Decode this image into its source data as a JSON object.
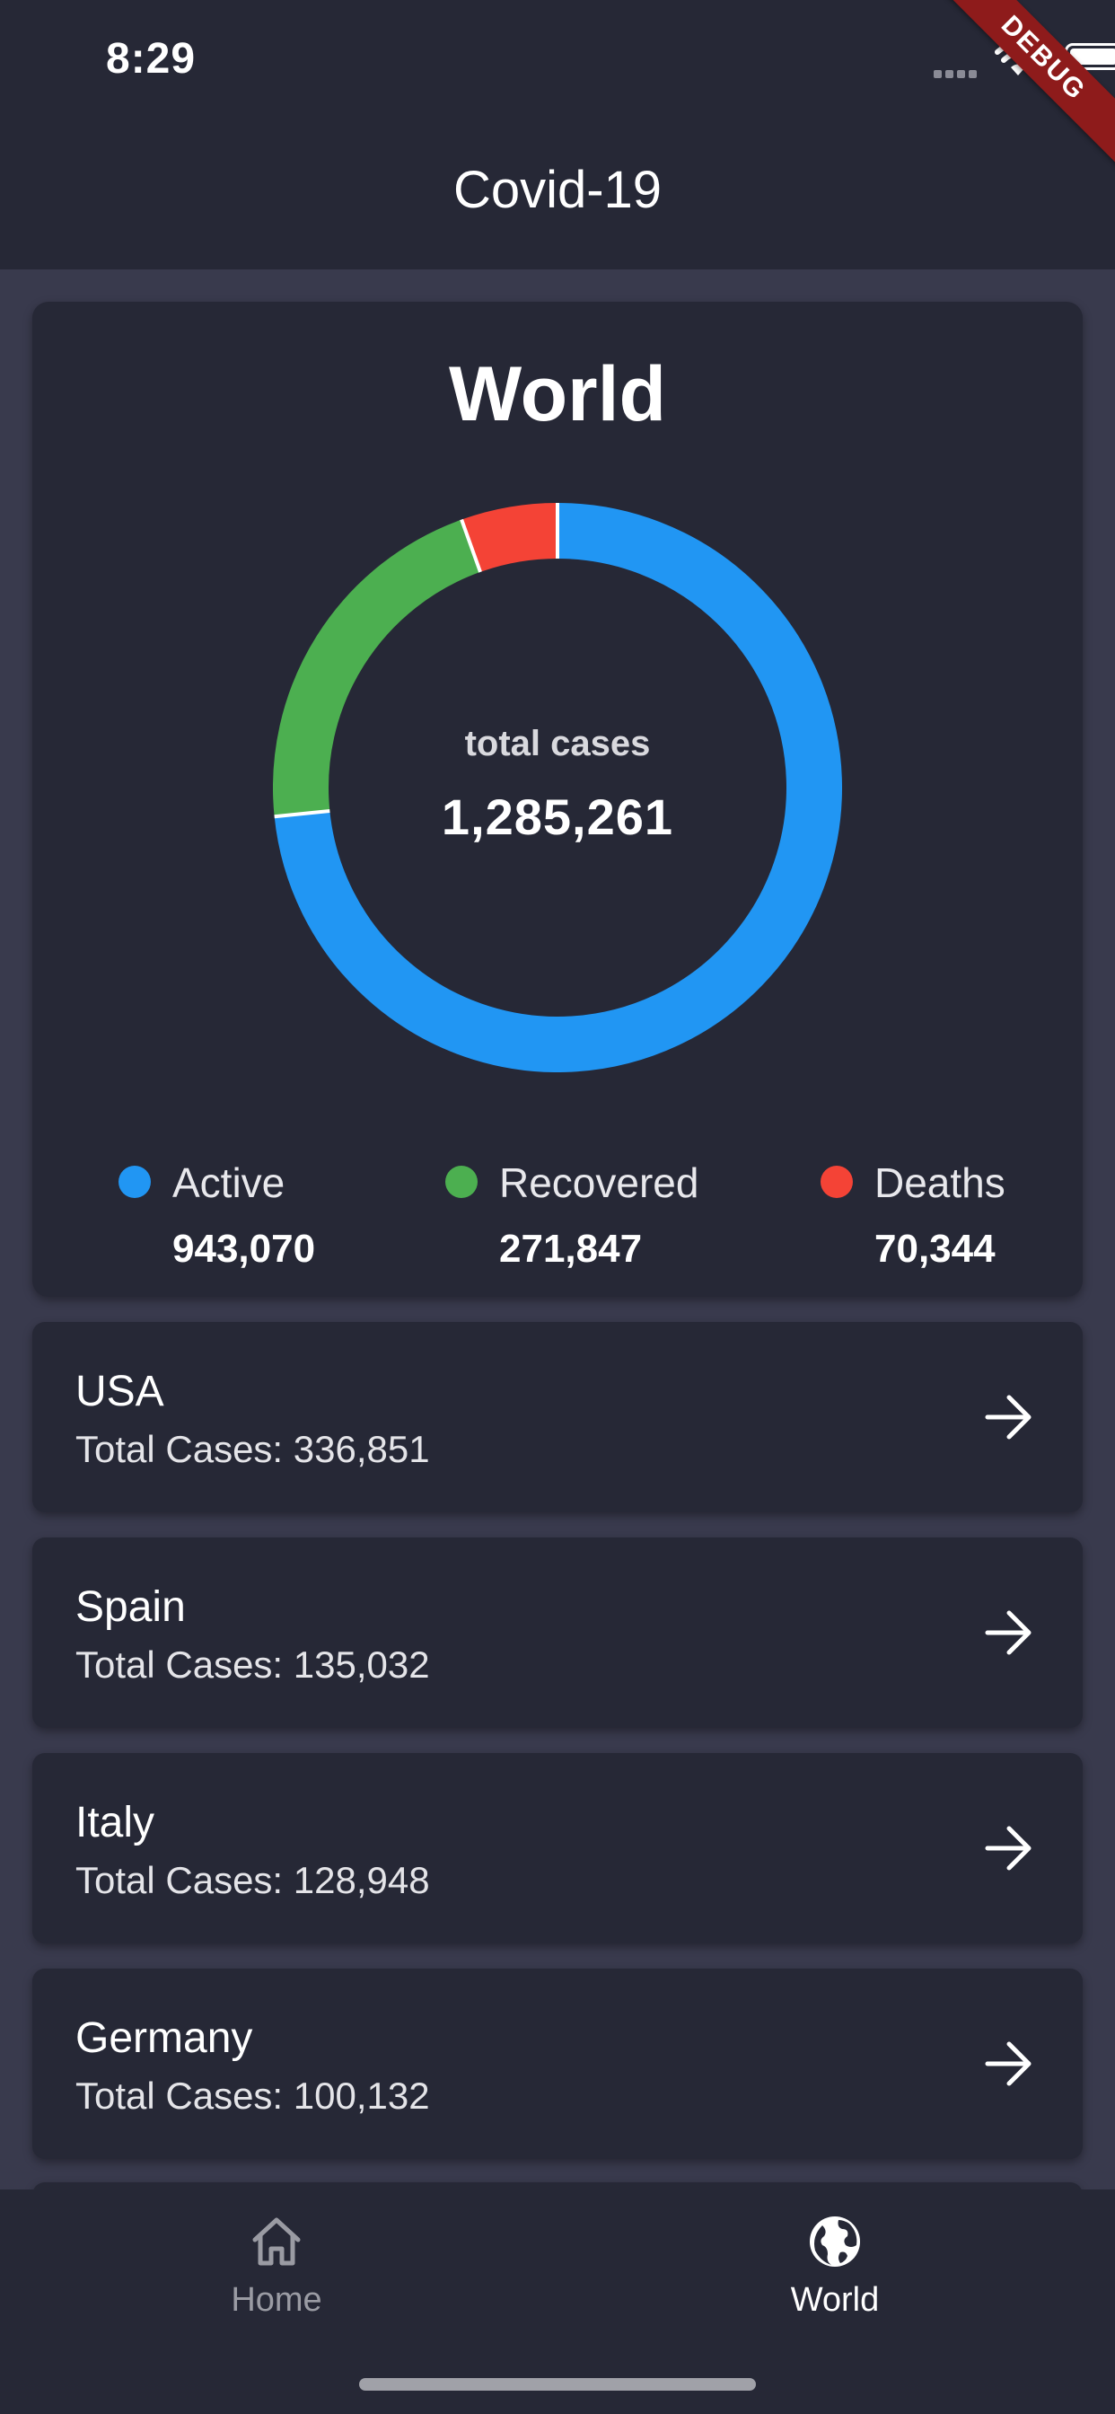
{
  "status_bar": {
    "time": "8:29",
    "debug_label": "DEBUG"
  },
  "app_bar": {
    "title": "Covid-19"
  },
  "world": {
    "title": "World",
    "total_label": "total cases",
    "total_value": "1,285,261",
    "legend": [
      {
        "label": "Active",
        "value": "943,070",
        "color": "#2196f3"
      },
      {
        "label": "Recovered",
        "value": "271,847",
        "color": "#4caf50"
      },
      {
        "label": "Deaths",
        "value": "70,344",
        "color": "#f44336"
      }
    ]
  },
  "chart_data": {
    "type": "pie",
    "categories": [
      "Active",
      "Recovered",
      "Deaths"
    ],
    "values": [
      943070,
      271847,
      70344
    ],
    "colors": [
      "#2196f3",
      "#4caf50",
      "#f44336"
    ],
    "title": "World"
  },
  "countries": [
    {
      "name": "USA",
      "total": "Total Cases: 336,851"
    },
    {
      "name": "Spain",
      "total": "Total Cases: 135,032"
    },
    {
      "name": "Italy",
      "total": "Total Cases: 128,948"
    },
    {
      "name": "Germany",
      "total": "Total Cases: 100,132"
    }
  ],
  "bottom_nav": [
    {
      "label": "Home",
      "icon": "home-icon",
      "active": false
    },
    {
      "label": "World",
      "icon": "globe-icon",
      "active": true
    }
  ]
}
